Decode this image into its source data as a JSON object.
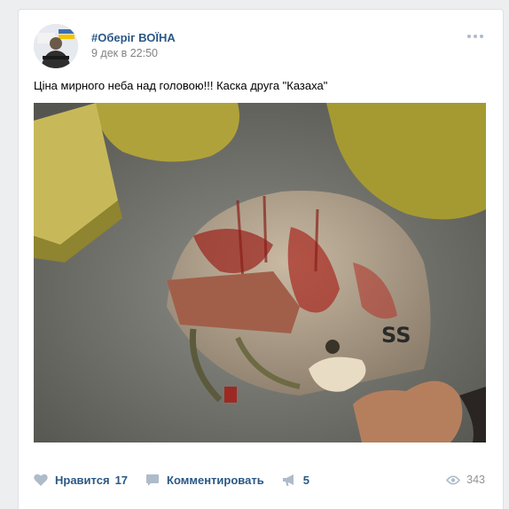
{
  "post": {
    "author": "#Оберіг ВОЇНА",
    "date": "9 дек в 22:50",
    "text": "Ціна мирного неба над головою!!! Каска друга \"Казаха\"",
    "photo_markings": "SS"
  },
  "actions": {
    "like_label": "Нравится",
    "like_count": "17",
    "comment_label": "Комментировать",
    "share_count": "5",
    "views_count": "343"
  },
  "icons": {
    "like": "heart-icon",
    "comment": "comment-icon",
    "share": "megaphone-icon",
    "views": "eye-icon",
    "more": "more-dots-icon"
  },
  "colors": {
    "link": "#2a5885",
    "icon": "#aebbc9",
    "muted": "#828282",
    "page_bg": "#edeef0",
    "card_bg": "#ffffff"
  }
}
